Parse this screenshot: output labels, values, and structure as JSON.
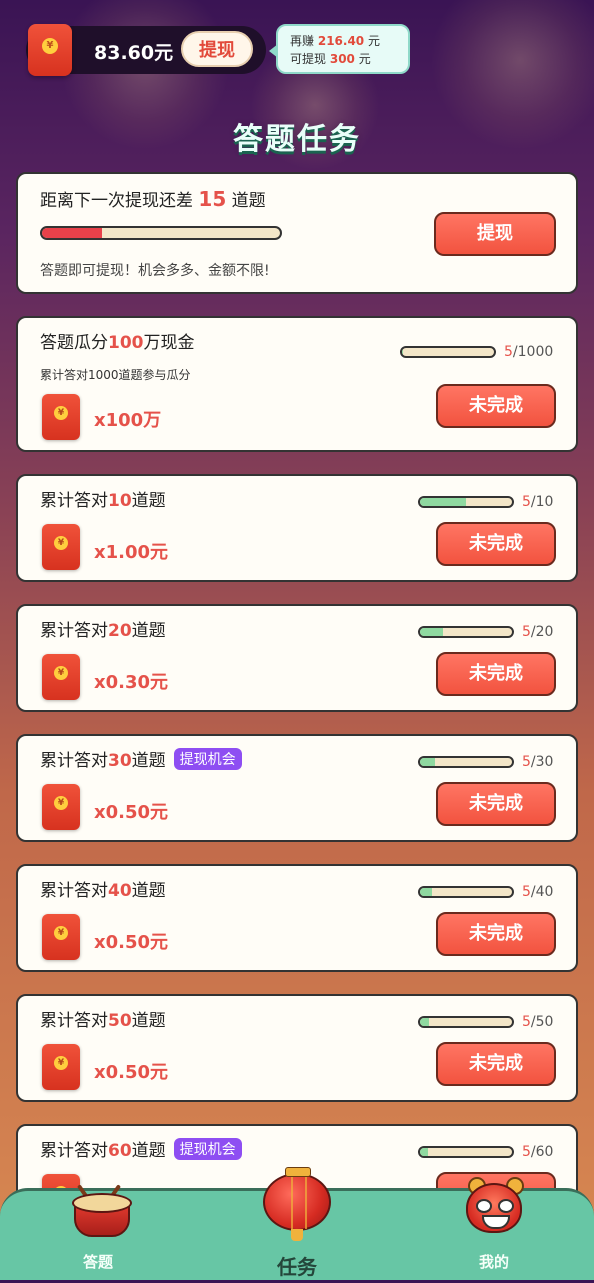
{
  "header": {
    "balance": "83.60元",
    "withdraw_label": "提现",
    "tip_line1_prefix": "再赚",
    "tip_line1_value": "216.40",
    "tip_line1_suffix": "元",
    "tip_line2_prefix": "可提现",
    "tip_line2_value": "300",
    "tip_line2_suffix": "元",
    "coin_glyph": "¥"
  },
  "page_title": "答题任务",
  "hero": {
    "text_prefix": "距离下一次提现还差",
    "remaining": "15",
    "text_suffix": "道题",
    "progress_fraction": 0.25,
    "subtitle": "答题即可提现！机会多多、金额不限!",
    "button_label": "提现"
  },
  "tasks": [
    {
      "title_prefix": "答题瓜分",
      "title_highlight": "100",
      "title_suffix": "万现金",
      "subtitle": "累计答对1000道题参与瓜分",
      "badge": "",
      "reward": "x100万",
      "current": "5",
      "total": "/1000",
      "fraction": 0.005,
      "button": "未完成"
    },
    {
      "title_prefix": "累计答对",
      "title_highlight": "10",
      "title_suffix": "道题",
      "subtitle": "",
      "badge": "",
      "reward": "x1.00元",
      "current": "5",
      "total": "/10",
      "fraction": 0.5,
      "button": "未完成"
    },
    {
      "title_prefix": "累计答对",
      "title_highlight": "20",
      "title_suffix": "道题",
      "subtitle": "",
      "badge": "",
      "reward": "x0.30元",
      "current": "5",
      "total": "/20",
      "fraction": 0.25,
      "button": "未完成"
    },
    {
      "title_prefix": "累计答对",
      "title_highlight": "30",
      "title_suffix": "道题",
      "subtitle": "",
      "badge": "提现机会",
      "reward": "x0.50元",
      "current": "5",
      "total": "/30",
      "fraction": 0.167,
      "button": "未完成"
    },
    {
      "title_prefix": "累计答对",
      "title_highlight": "40",
      "title_suffix": "道题",
      "subtitle": "",
      "badge": "",
      "reward": "x0.50元",
      "current": "5",
      "total": "/40",
      "fraction": 0.125,
      "button": "未完成"
    },
    {
      "title_prefix": "累计答对",
      "title_highlight": "50",
      "title_suffix": "道题",
      "subtitle": "",
      "badge": "",
      "reward": "x0.50元",
      "current": "5",
      "total": "/50",
      "fraction": 0.1,
      "button": "未完成"
    },
    {
      "title_prefix": "累计答对",
      "title_highlight": "60",
      "title_suffix": "道题",
      "subtitle": "",
      "badge": "提现机会",
      "reward": "",
      "current": "5",
      "total": "/60",
      "fraction": 0.083,
      "button": ""
    }
  ],
  "nav": {
    "items": [
      {
        "label": "答题",
        "icon": "drum-icon",
        "active": false
      },
      {
        "label": "任务",
        "icon": "lantern-icon",
        "active": true
      },
      {
        "label": "我的",
        "icon": "lion-dance-icon",
        "active": false
      }
    ]
  },
  "colors": {
    "accent_red": "#e5524a",
    "button_red": "#f2533f",
    "badge_purple": "#8e4ef2",
    "nav_green": "#67c6a5",
    "progress_green": "#8fd9a0"
  }
}
